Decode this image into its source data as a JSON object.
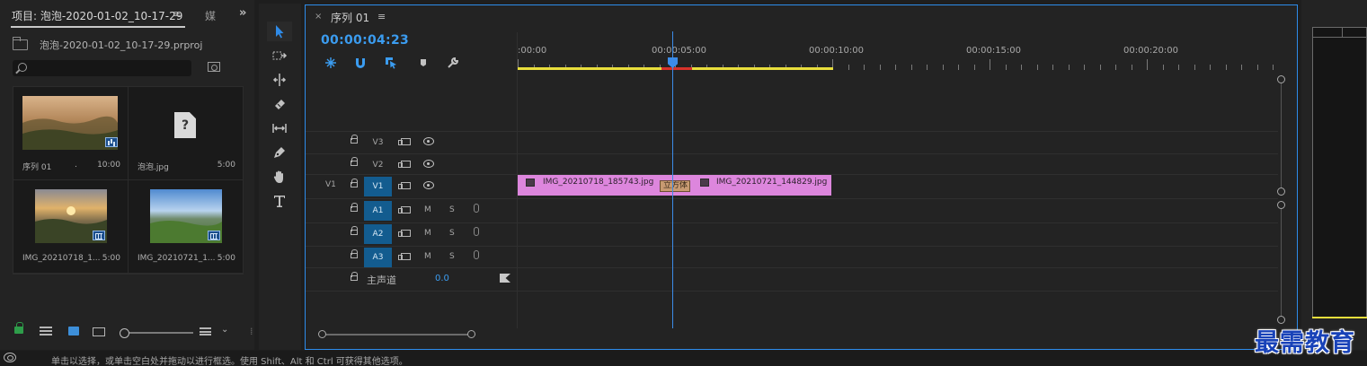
{
  "project": {
    "tab_label": "项目: 泡泡-2020-01-02_10-17-29",
    "tab_menu": "≡",
    "tab2_label": "媒",
    "overflow": "»",
    "file_name": "泡泡-2020-01-02_10-17-29.prproj",
    "search_placeholder": "",
    "items": [
      {
        "name": "序列 01",
        "duration": "10:00",
        "kind": "sequence"
      },
      {
        "name": "泡泡.jpg",
        "duration": "5:00",
        "kind": "missing"
      },
      {
        "name": "IMG_20210718_1...",
        "duration": "5:00",
        "kind": "image"
      },
      {
        "name": "IMG_20210721_1...",
        "duration": "5:00",
        "kind": "image"
      }
    ],
    "seq_extra": "."
  },
  "tools": [
    "selection-tool",
    "track-select-tool",
    "ripple-edit-tool",
    "razor-tool",
    "slip-tool",
    "pen-tool",
    "hand-tool",
    "type-tool"
  ],
  "timeline": {
    "tab_close": "×",
    "tab_title": "序列 01",
    "tab_menu": "≡",
    "timecode": "00:00:04:23",
    "ruler_labels": [
      ":00:00",
      "00:00:05:00",
      "00:00:10:00",
      "00:00:15:00",
      "00:00:20:00"
    ],
    "tracks": {
      "v3": "V3",
      "v2": "V2",
      "v1": "V1",
      "v1_source": "V1",
      "a1": "A1",
      "a2": "A2",
      "a3": "A3",
      "mute": "M",
      "solo": "S",
      "master_label": "主声道",
      "master_value": "0.0"
    },
    "clips": [
      {
        "label": "IMG_20210718_185743.jpg"
      },
      {
        "label": "IMG_20210721_144829.jpg"
      }
    ],
    "transition_label": "立方体"
  },
  "status": {
    "text": "单击以选择，或单击空白处并拖动以进行框选。使用 Shift、Alt 和 Ctrl 可获得其他选项。"
  },
  "watermark": "最需教育",
  "colors": {
    "accent": "#2d8ceb",
    "clip": "#dd86dd",
    "work_area": "#e8de3c",
    "render_red": "#d8322a",
    "track_selected": "#135c8f"
  }
}
